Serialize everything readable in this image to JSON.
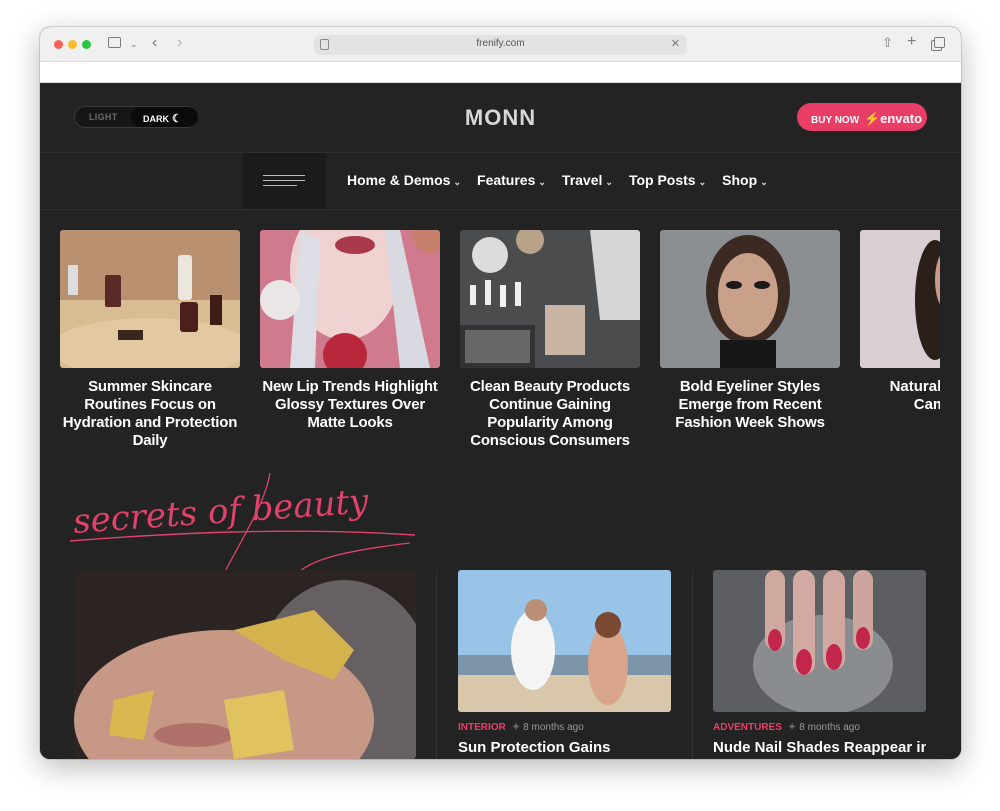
{
  "browser": {
    "url": "frenify.com"
  },
  "header": {
    "mode_light": "LIGHT",
    "mode_dark": "DARK",
    "logo": "MONN",
    "buy_label": "BUY NOW",
    "buy_brand": "envato"
  },
  "nav": {
    "items": [
      {
        "label": "Home & Demos"
      },
      {
        "label": "Features"
      },
      {
        "label": "Travel"
      },
      {
        "label": "Top Posts"
      },
      {
        "label": "Shop"
      }
    ]
  },
  "slider": {
    "cards": [
      {
        "title": "Summer Skincare Routines Focus on Hydration and Protection Daily"
      },
      {
        "title": "New Lip Trends Highlight Glossy Textures Over Matte Looks"
      },
      {
        "title": "Clean Beauty Products Continue Gaining Popularity Among Conscious Consumers"
      },
      {
        "title": "Bold Eyeliner Styles Emerge from Recent Fashion Week Shows"
      },
      {
        "title": "Natural Spotlight Campaign"
      }
    ]
  },
  "section": {
    "script_title": "secrets of beauty"
  },
  "posts": [
    {
      "category": "INTERIOR",
      "date": "8 months ago",
      "title": "Sun Protection Gains"
    },
    {
      "category": "ADVENTURES",
      "date": "8 months ago",
      "title": "Nude Nail Shades Reappear in"
    }
  ],
  "colors": {
    "accent": "#e83e66",
    "background": "#232323",
    "text": "#ffffff"
  }
}
